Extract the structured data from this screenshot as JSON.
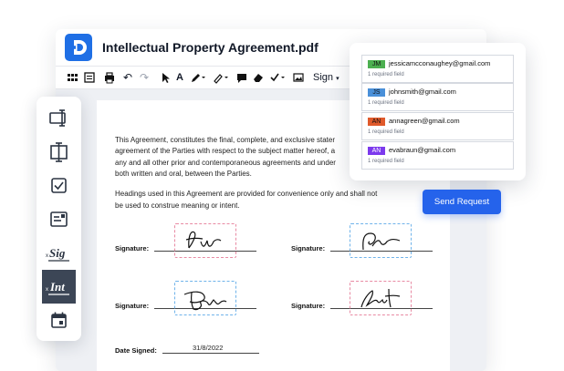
{
  "document": {
    "title": "Intellectual Property Agreement.pdf",
    "toolbar": {
      "sign_label": "Sign"
    },
    "paragraphs": [
      "This Agreement, constitutes the final, complete, and exclusive stater",
      "agreement of the Parties with respect to the subject matter hereof, a",
      "any and all other prior and contemporaneous agreements and under",
      "both written and oral, between the Parties.",
      "Headings used in this Agreement are provided for convenience only and shall not",
      "be used to construe meaning or intent."
    ],
    "signature_label": "Signature:",
    "date_signed_label": "Date Signed:",
    "date_signed_value": "31/8/2022"
  },
  "signers": [
    {
      "initials": "JM",
      "email": "jessicamcconaughey@gmail.com",
      "note": "1 required field",
      "color": "#4caf50"
    },
    {
      "initials": "JS",
      "email": "johnsmith@gmail.com",
      "note": "1 required field",
      "color": "#4a90d9"
    },
    {
      "initials": "AN",
      "email": "annagreen@gmail.com",
      "note": "1 required field",
      "color": "#e05a2b"
    },
    {
      "initials": "AN",
      "email": "evabraun@gmail.com",
      "note": "1 required field",
      "color": "#7c3aed"
    }
  ],
  "send_button": "Send Request",
  "sidebar_tools": [
    {
      "icon": "text-field-icon"
    },
    {
      "icon": "text-box-icon"
    },
    {
      "icon": "checkbox-icon"
    },
    {
      "icon": "form-field-icon"
    },
    {
      "icon": "signature-icon",
      "label": "Sig"
    },
    {
      "icon": "initials-icon",
      "label": "Int"
    },
    {
      "icon": "calendar-icon"
    }
  ],
  "colors": {
    "brand": "#1f6fe5",
    "button": "#2563eb",
    "active_tool": "#3c4656"
  }
}
